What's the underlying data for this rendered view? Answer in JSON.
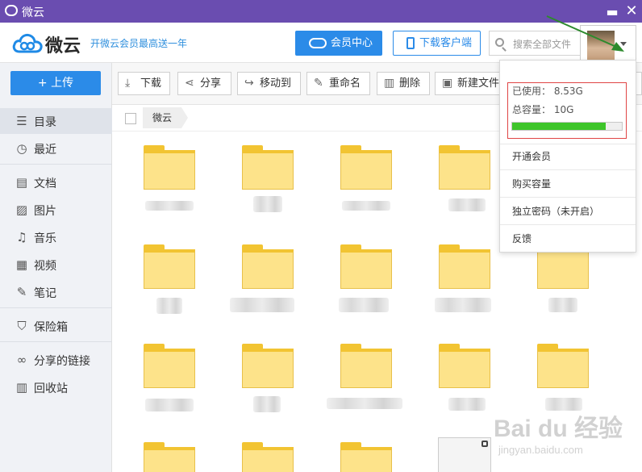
{
  "window": {
    "title": "微云",
    "minimize": "▬",
    "close": "✕"
  },
  "header": {
    "brand": "微云",
    "promo": "开微云会员最高送一年",
    "vip_button": "会员中心",
    "download_button": "下载客户端",
    "search_placeholder": "搜索全部文件"
  },
  "sidebar": {
    "upload": "+ 上传",
    "items": [
      {
        "label": "目录",
        "icon": "list-icon",
        "glyph": "☰",
        "active": true
      },
      {
        "label": "最近",
        "icon": "clock-icon",
        "glyph": "◷"
      },
      {
        "label": "文档",
        "icon": "document-icon",
        "glyph": "▤"
      },
      {
        "label": "图片",
        "icon": "image-icon",
        "glyph": "▨"
      },
      {
        "label": "音乐",
        "icon": "music-icon",
        "glyph": "♫"
      },
      {
        "label": "视频",
        "icon": "video-icon",
        "glyph": "▦"
      },
      {
        "label": "笔记",
        "icon": "note-icon",
        "glyph": "✎"
      },
      {
        "label": "保险箱",
        "icon": "shield-icon",
        "glyph": "⛉"
      },
      {
        "label": "分享的链接",
        "icon": "link-icon",
        "glyph": "∞"
      },
      {
        "label": "回收站",
        "icon": "trash-icon",
        "glyph": "▥"
      }
    ]
  },
  "toolbar": {
    "items": [
      {
        "label": "下载",
        "icon": "download-icon",
        "glyph": "⤓"
      },
      {
        "label": "分享",
        "icon": "share-icon",
        "glyph": "⋖"
      },
      {
        "label": "移动到",
        "icon": "move-icon",
        "glyph": "↪"
      },
      {
        "label": "重命名",
        "icon": "rename-icon",
        "glyph": "✎"
      },
      {
        "label": "删除",
        "icon": "delete-icon",
        "glyph": "▥"
      },
      {
        "label": "新建文件",
        "icon": "new-folder-icon",
        "glyph": "▣"
      }
    ]
  },
  "breadcrumb": {
    "root": "微云"
  },
  "storage_menu": {
    "used": "已使用： 8.53G",
    "total": "总容量： 10G",
    "usage_fraction": 0.853,
    "items": [
      "开通会员",
      "购买容量",
      "独立密码（未开启）",
      "反馈"
    ]
  },
  "watermark": {
    "line1": "Bai du 经验",
    "line2": "jingyan.baidu.com"
  }
}
